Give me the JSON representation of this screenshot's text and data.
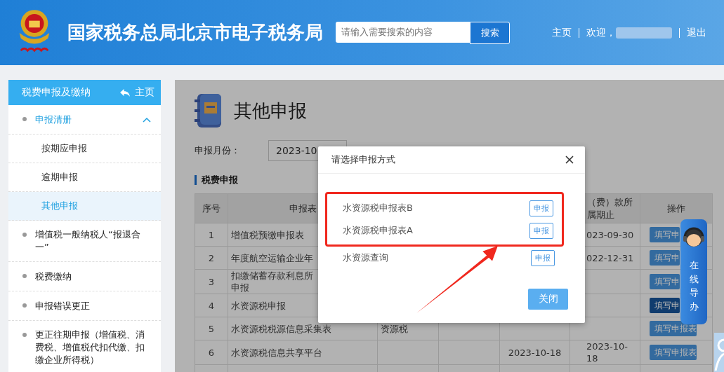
{
  "header": {
    "title": "国家税务总局北京市电子税务局",
    "search": {
      "placeholder": "请输入需要搜索的内容",
      "button": "搜索"
    },
    "nav": {
      "home": "主页",
      "welcome": "欢迎，",
      "logout": "退出"
    }
  },
  "sidebar": {
    "title": "税费申报及缴纳",
    "home": "主页",
    "items": [
      {
        "label": "申报清册",
        "expanded": true,
        "children": [
          {
            "label": "按期应申报",
            "selected": false
          },
          {
            "label": "逾期申报",
            "selected": false
          },
          {
            "label": "其他申报",
            "selected": true
          }
        ]
      },
      {
        "label": "增值税一般纳税人“报退合一”",
        "expanded": false
      },
      {
        "label": "税费缴纳",
        "expanded": false
      },
      {
        "label": "申报错误更正",
        "expanded": false
      },
      {
        "label": "更正往期申报（增值税、消费税、增值税代扣代缴、扣缴企业所得税）",
        "expanded": false
      }
    ]
  },
  "main": {
    "title": "其他申报",
    "month_label": "申报月份：",
    "month_value": "2023-10",
    "section": "税费申报",
    "table": {
      "columns": [
        "序号",
        "申报表",
        null,
        null,
        null,
        "（费）款所属期止",
        "操作"
      ],
      "rows": [
        {
          "cells": [
            "1",
            "增值税预缴申报表",
            null,
            null,
            null,
            "023-09-30"
          ],
          "action": "填写申",
          "highlighted": false
        },
        {
          "cells": [
            "2",
            "年度航空运输企业年",
            null,
            null,
            null,
            "022-12-31"
          ],
          "action": "填写申",
          "highlighted": false
        },
        {
          "cells": [
            "3",
            [
              "扣缴储蓄存款利息所",
              "申报"
            ],
            null,
            null,
            null,
            null
          ],
          "action": "填写申",
          "highlighted": false
        },
        {
          "cells": [
            "4",
            "水资源税申报",
            null,
            null,
            null,
            null
          ],
          "action": "填写申",
          "highlighted": true
        },
        {
          "cells": [
            "5",
            "水资源税税源信息采集表",
            "资源税",
            null,
            null,
            null
          ],
          "action": "填写申报表",
          "highlighted": false
        },
        {
          "cells": [
            "6",
            "水资源税信息共享平台",
            null,
            null,
            "2023-10-18",
            "2023-10-18"
          ],
          "action": "填写申报表",
          "highlighted": false
        }
      ]
    }
  },
  "dialog": {
    "title": "请选择申报方式",
    "options": [
      {
        "label": "水资源税申报表B",
        "button": "申报",
        "highlighted": true
      },
      {
        "label": "水资源税申报表A",
        "button": "申报",
        "highlighted": true
      },
      {
        "label": "水资源查询",
        "button": "申报",
        "highlighted": false
      }
    ],
    "close_button": "关闭"
  },
  "guide_widget": {
    "label": "在线导办"
  }
}
